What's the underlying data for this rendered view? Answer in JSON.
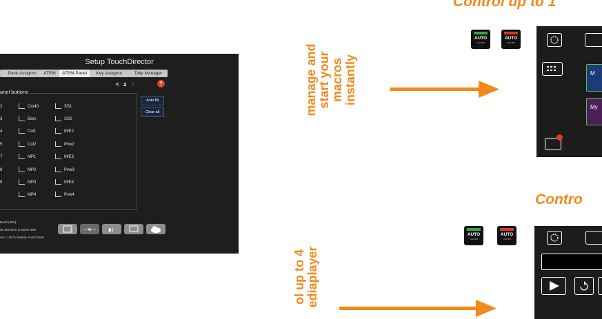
{
  "setup": {
    "title": "Setup TouchDirector",
    "tabs": [
      "Deck Assignm.",
      "ATEM",
      "ATEM Panel",
      "Key Assignm.",
      "Tally Manager"
    ],
    "active_tab": "ATEM Panel",
    "pager": {
      "prev": "<",
      "page": "2",
      "next": ">"
    },
    "help": "?",
    "group_title": "anel buttons",
    "columns": [
      {
        "items": [
          "2",
          "3",
          "4",
          "5",
          "7",
          "8",
          "9"
        ]
      },
      {
        "items": [
          "Cm40",
          "Bars",
          "Col1",
          "Col2",
          "MP1",
          "MP2",
          "MP3",
          "MP4"
        ]
      },
      {
        "items": [
          "SS1",
          "SS2",
          "M/E2",
          "Pvw2",
          "M/E3",
          "Pvw3",
          "M/E4",
          "Pvw4"
        ]
      }
    ],
    "side_buttons": {
      "auto_fill": "Auto fill",
      "clear_all": "Clear all"
    },
    "footer": [
      " Build (362)",
      "ds Meinsen & Ebelt GbR",
      "sen, Ulrich Saskia-Anett Ebelt"
    ]
  },
  "right": {
    "heading_top": "Control up to 1",
    "heading_bottom": "Contro",
    "vtext_top": [
      "manage and",
      "start your",
      "macros",
      "instantly"
    ],
    "vtext_bottom": [
      "ol up to 4",
      "ediaplayer"
    ],
    "auto_buttons": [
      {
        "label": "AUTO",
        "sub": "1:00  MIX",
        "bar_color": "#2fa84f"
      },
      {
        "label": "AUTO",
        "sub": "1:00  MIX",
        "bar_color": "#e0342a"
      }
    ],
    "macro_labels": [
      "M",
      "My"
    ],
    "accent_color": "#f28a1a"
  }
}
